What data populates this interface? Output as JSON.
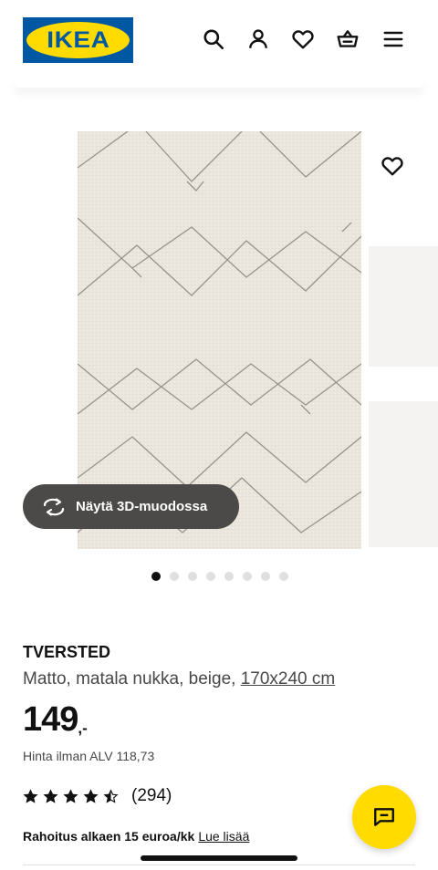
{
  "brand": {
    "logo_text": "IKEA",
    "blue": "#0058A3",
    "yellow": "#FFDB00"
  },
  "header": {
    "icons": [
      "search-icon",
      "user-icon",
      "heart-icon",
      "shopping-basket-icon",
      "menu-icon"
    ]
  },
  "gallery": {
    "view_3d_label": "Näytä 3D-muodossa",
    "image_count": 8,
    "active_index": 0,
    "favorite_icon": "heart-icon"
  },
  "product": {
    "name": "TVERSTED",
    "description": "Matto, matala nukka, beige, ",
    "size": "170x240 cm",
    "price_integer": "149",
    "price_suffix": ",-",
    "vat_text": "Hinta ilman ALV 118,73",
    "rating": 4.5,
    "review_count": "(294)",
    "financing_text": "Rahoitus alkaen 15 euroa/kk",
    "financing_link": "Lue lisää"
  },
  "chat": {
    "icon": "chat-icon"
  }
}
